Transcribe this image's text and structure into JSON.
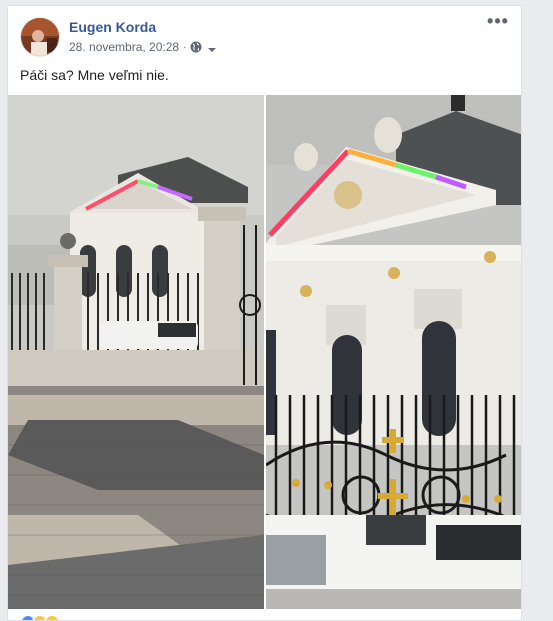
{
  "post": {
    "author": "Eugen Korda",
    "timestamp": "28. novembra, 20:28",
    "privacy_icon": "globe-icon",
    "audience_caret_icon": "caret-down-icon",
    "more_icon": "more-options-icon",
    "more_label": "•••",
    "text": "Páči sa? Mne veľmi nie.",
    "photos": [
      {
        "name": "palace-photo-wide",
        "description_icon": "photo"
      },
      {
        "name": "palace-photo-closeup",
        "description_icon": "photo"
      }
    ],
    "reaction_icons": [
      "like-icon",
      "haha-icon",
      "wow-icon"
    ]
  },
  "colors": {
    "link": "#385898",
    "secondary_text": "#606770",
    "background": "#e9ebee",
    "card": "#ffffff"
  }
}
